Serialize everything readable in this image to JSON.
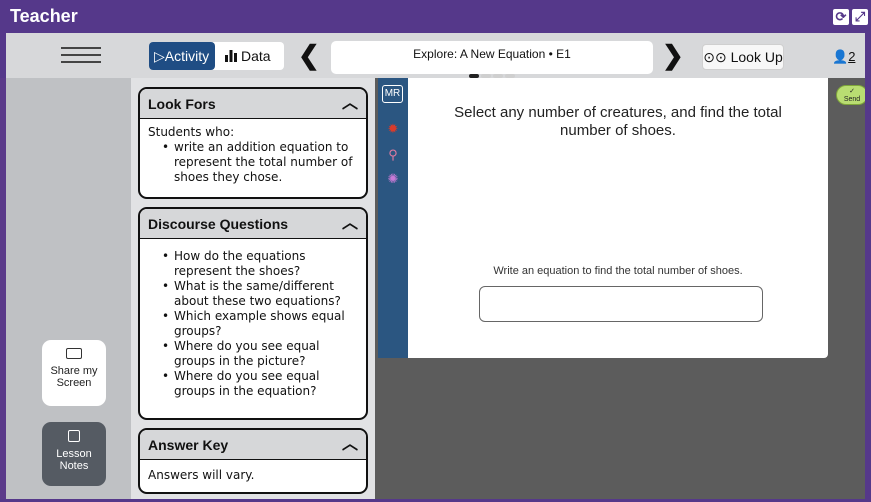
{
  "window": {
    "title": "Teacher",
    "refresh_glyph": "⟳",
    "expand_glyph": "⤢"
  },
  "toolbar": {
    "activity_label": "▷Activity",
    "data_label": "Data",
    "data_icon": "bar-chart-icon",
    "prev_glyph": "❮",
    "next_glyph": "❯",
    "lesson_title": "Explore: A New Equation • E1",
    "lookup_label": "⊙⊙ Look Up",
    "user_count": "2",
    "user_icon": "👤"
  },
  "leftrail": {
    "share_label": "Share my Screen",
    "notes_label": "Lesson Notes"
  },
  "notes": {
    "look_fors": {
      "title": "Look Fors",
      "intro": "Students who:",
      "items": [
        "write an addition equation to represent the total number of shoes they chose."
      ]
    },
    "discourse": {
      "title": "Discourse Questions",
      "items": [
        "How do the equations represent the shoes?",
        "What is the same/different about these two equations?",
        "Which example shows equal groups?",
        "Where do you see equal groups in the picture?",
        "Where do you see equal groups in the equation?"
      ]
    },
    "answer_key": {
      "title": "Answer Key",
      "text": "Answers will vary."
    },
    "caret": "︿"
  },
  "strip": {
    "mr_label": "MR"
  },
  "sheet": {
    "prompt": "Select any number of creatures, and find the total number of shoes.",
    "instruction": "Write an equation to find the total number of shoes.",
    "answer_value": ""
  },
  "send": {
    "check": "✓",
    "label": "Send"
  },
  "colors": {
    "brand": "#55388a",
    "activity": "#1f4d84",
    "strip": "#2b5681",
    "send": "#b9dd72"
  }
}
